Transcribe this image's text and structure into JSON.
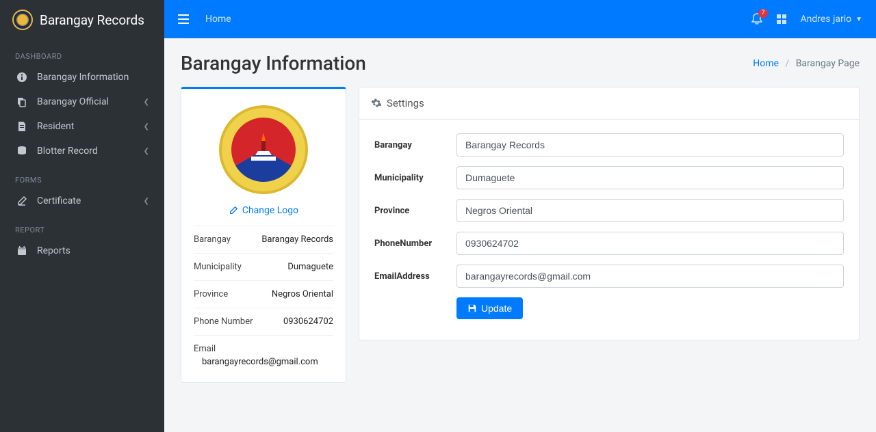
{
  "brand": {
    "name": "Barangay Records"
  },
  "sidebar": {
    "sections": {
      "dashboard": {
        "heading": "DASHBOARD",
        "items": [
          {
            "label": "Barangay Information",
            "icon": "info-circle-icon"
          },
          {
            "label": "Barangay Official",
            "icon": "copy-icon",
            "chev": true
          },
          {
            "label": "Resident",
            "icon": "file-icon",
            "chev": true
          },
          {
            "label": "Blotter Record",
            "icon": "database-icon",
            "chev": true
          }
        ]
      },
      "forms": {
        "heading": "FORMS",
        "items": [
          {
            "label": "Certificate",
            "icon": "edit-icon",
            "chev": true
          }
        ]
      },
      "report": {
        "heading": "REPORT",
        "items": [
          {
            "label": "Reports",
            "icon": "calendar-icon"
          }
        ]
      }
    }
  },
  "topbar": {
    "home": "Home",
    "notif_count": "7",
    "user": "Andres jario"
  },
  "page": {
    "title": "Barangay Information",
    "breadcrumb": {
      "home": "Home",
      "current": "Barangay Page"
    }
  },
  "info_card": {
    "change_logo": "Change Logo",
    "rows": {
      "barangay_k": "Barangay",
      "barangay_v": "Barangay Records",
      "municipality_k": "Municipality",
      "municipality_v": "Dumaguete",
      "province_k": "Province",
      "province_v": "Negros Oriental",
      "phone_k": "Phone Number",
      "phone_v": "0930624702",
      "email_k": "Email",
      "email_v": "barangayrecords@gmail.com"
    }
  },
  "form_card": {
    "header": "Settings",
    "labels": {
      "barangay": "Barangay",
      "municipality": "Municipality",
      "province": "Province",
      "phone": "PhoneNumber",
      "email": "EmailAddress"
    },
    "values": {
      "barangay": "Barangay Records",
      "municipality": "Dumaguete",
      "province": "Negros Oriental",
      "phone": "0930624702",
      "email": "barangayrecords@gmail.com"
    },
    "update_label": "Update"
  }
}
